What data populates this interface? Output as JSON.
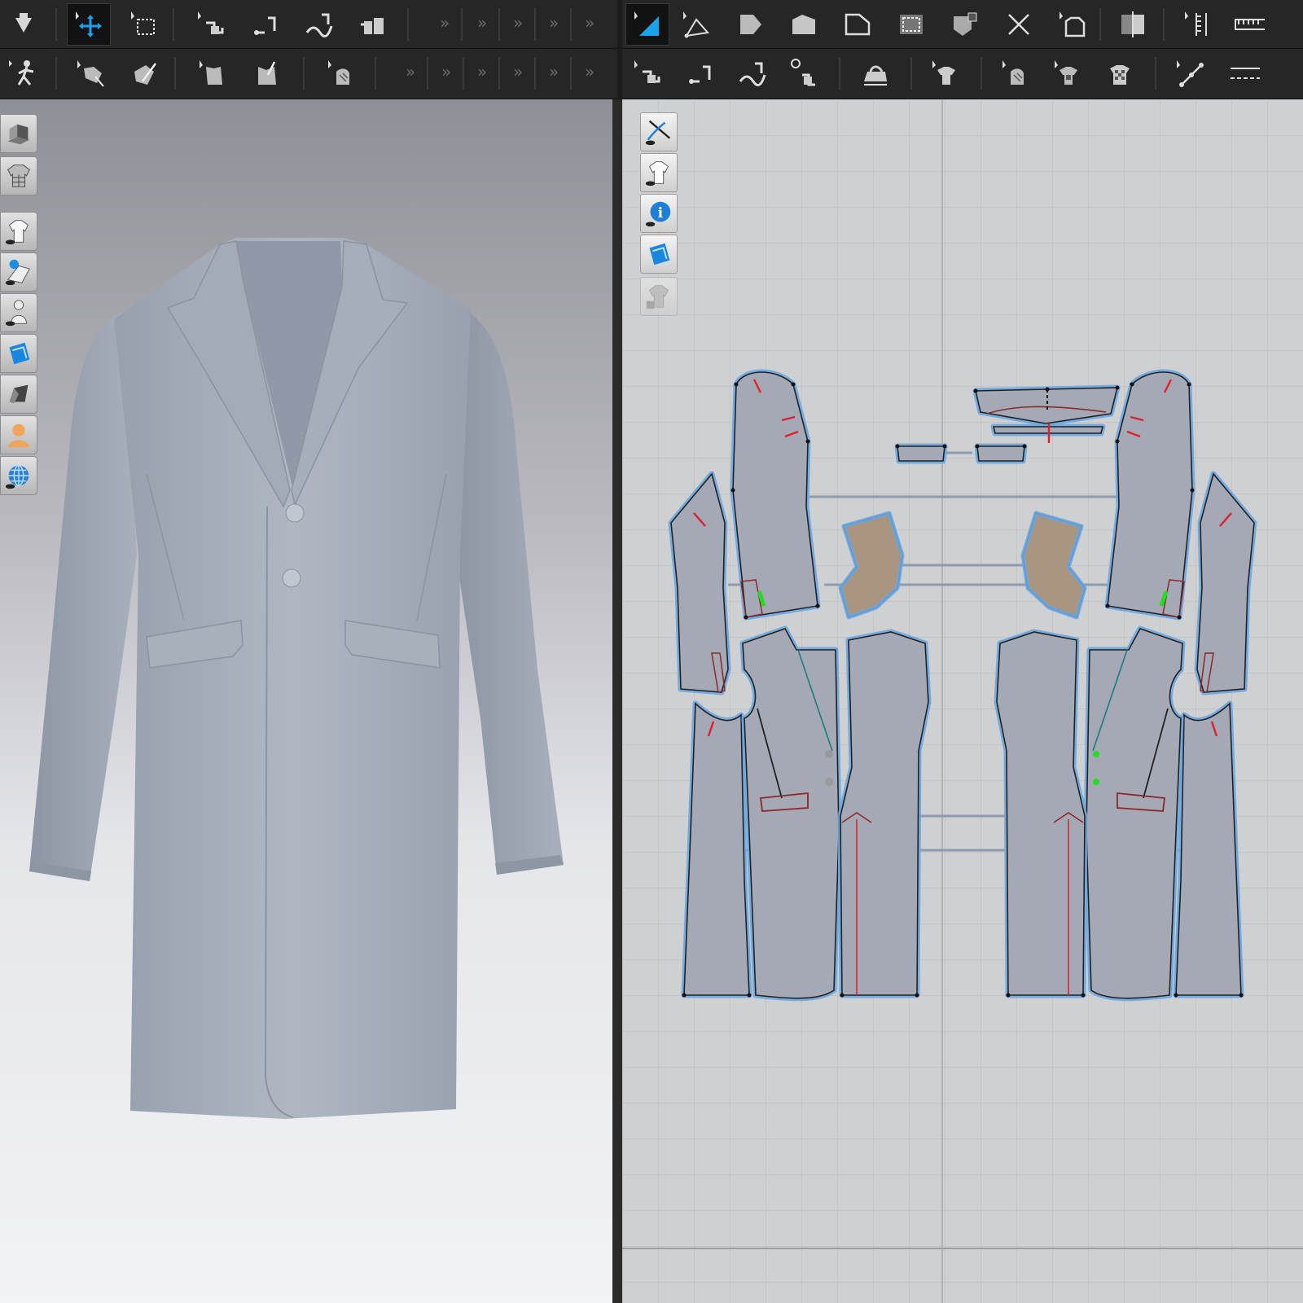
{
  "toolbar_top_left": [
    {
      "name": "import-arrow-icon",
      "active": false
    },
    {
      "name": "move-select-icon",
      "active": true
    },
    {
      "name": "box-select-icon",
      "active": false
    },
    {
      "name": "sew-segment-icon",
      "active": false
    },
    {
      "name": "sew-free-icon",
      "active": false
    },
    {
      "name": "sew-curve-icon",
      "active": false
    },
    {
      "name": "sew-multi-icon",
      "active": false
    }
  ],
  "toolbar_top_right": [
    {
      "name": "edit-pattern-icon",
      "active": true
    },
    {
      "name": "edit-point-icon",
      "active": false
    },
    {
      "name": "edit-curve-icon",
      "active": false
    },
    {
      "name": "rectangle-shape-icon",
      "active": false
    },
    {
      "name": "polygon-shape-icon",
      "active": false
    },
    {
      "name": "internal-polygon-icon",
      "active": false
    },
    {
      "name": "dart-icon",
      "active": false
    },
    {
      "name": "cut-icon",
      "active": false
    },
    {
      "name": "notch-tool-icon",
      "active": false
    },
    {
      "name": "symmetric-icon",
      "active": false
    },
    {
      "name": "ruler-icon",
      "active": false
    },
    {
      "name": "tape-icon",
      "active": false
    }
  ],
  "toolbar_second_left": [
    {
      "name": "simulate-avatar-icon"
    },
    {
      "name": "select-mesh-icon"
    },
    {
      "name": "pin-tool-icon"
    },
    {
      "name": "tack-icon"
    },
    {
      "name": "steam-icon"
    },
    {
      "name": "fabric-fold-icon"
    }
  ],
  "toolbar_second_right": [
    {
      "name": "segment-sew-2d-icon"
    },
    {
      "name": "free-sew-2d-icon"
    },
    {
      "name": "curve-sew-2d-icon"
    },
    {
      "name": "check-sewing-icon"
    },
    {
      "name": "iron-icon"
    },
    {
      "name": "arrangement-point-icon"
    },
    {
      "name": "texture-edit-icon"
    },
    {
      "name": "fabric-pattern-icon"
    },
    {
      "name": "checker-shirt-icon"
    },
    {
      "name": "line-tool-icon"
    },
    {
      "name": "dashed-line-icon"
    }
  ],
  "side_tools_3d": [
    {
      "name": "render-mode-icon"
    },
    {
      "name": "garment-wireframe-icon"
    },
    {
      "name": "show-garment-icon"
    },
    {
      "name": "show-fabric-icon"
    },
    {
      "name": "show-avatar-icon"
    },
    {
      "name": "uv-editor-icon"
    },
    {
      "name": "shading-icon"
    },
    {
      "name": "avatar-skin-icon"
    },
    {
      "name": "environment-globe-icon"
    }
  ],
  "side_tools_2d": [
    {
      "name": "show-sewing-lines-icon",
      "disabled": false
    },
    {
      "name": "show-pattern-icon",
      "disabled": false
    },
    {
      "name": "pattern-info-icon",
      "disabled": false
    },
    {
      "name": "show-texture-icon",
      "disabled": false
    },
    {
      "name": "locked-garment-icon",
      "disabled": true
    }
  ],
  "colors": {
    "toolbar_bg": "#262626",
    "active_accent": "#1aa3e8",
    "pattern_fill": "#a5a9b5",
    "pattern_halo": "#6aa6e0",
    "facing_fill": "#a99580",
    "notch_red": "#e0202a",
    "sew_green": "#22dd22",
    "garment_fabric": "#a9b0bd"
  }
}
